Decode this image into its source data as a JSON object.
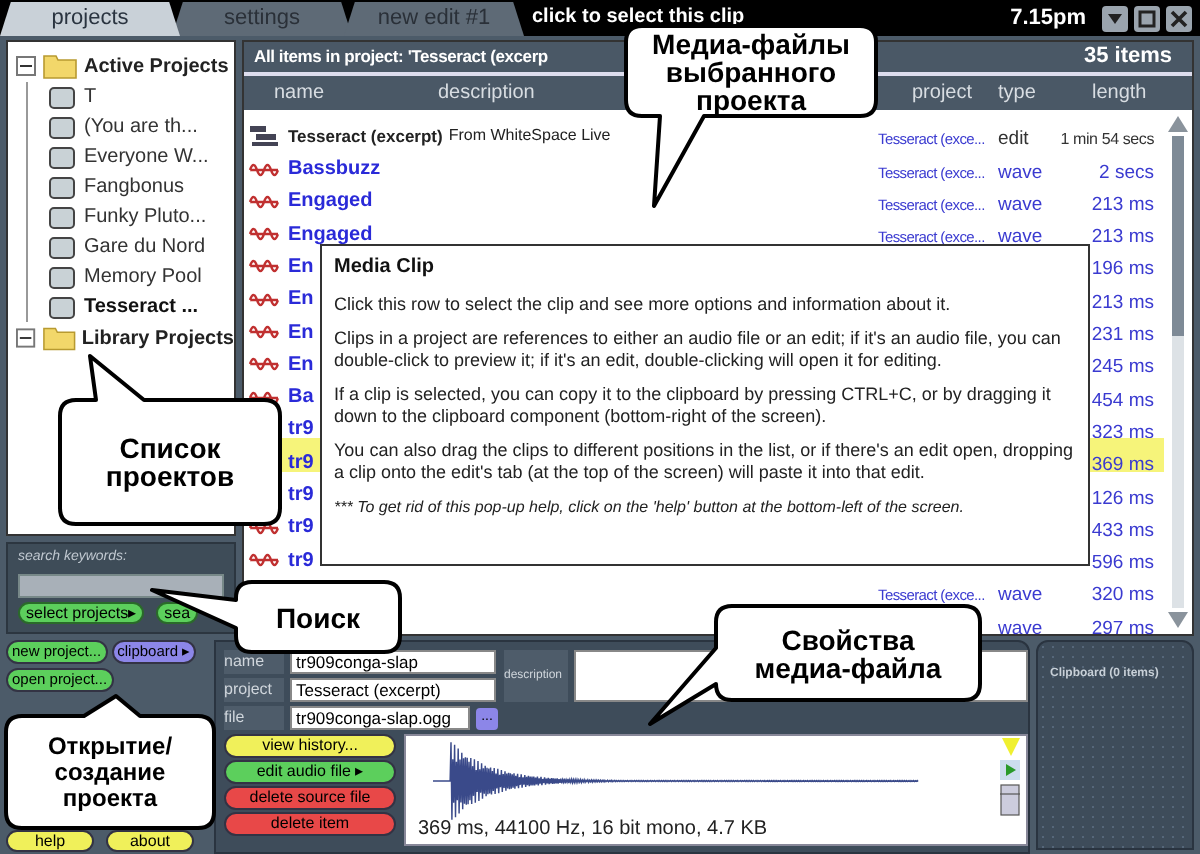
{
  "tabs": [
    {
      "label": "projects",
      "selected": true
    },
    {
      "label": "settings",
      "selected": false
    },
    {
      "label": "new edit #1",
      "selected": false
    }
  ],
  "hint": "click to select this clip",
  "clock": "7.15pm",
  "project_tree": [
    {
      "label": "Active Projects",
      "expanded": true,
      "children": [
        {
          "label": "T",
          "selected": false
        },
        {
          "label": "(You are th...",
          "selected": false
        },
        {
          "label": "Everyone W...",
          "selected": false
        },
        {
          "label": "Fangbonus",
          "selected": false
        },
        {
          "label": "Funky Pluto...",
          "selected": false
        },
        {
          "label": "Gare du Nord",
          "selected": false
        },
        {
          "label": "Memory Pool",
          "selected": false
        },
        {
          "label": "Tesseract ...",
          "selected": true
        }
      ]
    },
    {
      "label": "Library Projects",
      "expanded": true
    }
  ],
  "search": {
    "label": "search keywords:",
    "buttons": [
      {
        "label": "select projects▸"
      },
      {
        "label": "sea"
      }
    ]
  },
  "project_buttons": [
    {
      "label": "new project...",
      "color": "#5ccf5c"
    },
    {
      "label": "clipboard ▸",
      "color": "#8c86e8"
    },
    {
      "label": "open project...",
      "color": "#5ccf5c"
    }
  ],
  "bottom_buttons": [
    {
      "label": "help"
    },
    {
      "label": "about"
    }
  ],
  "list": {
    "title": "All items in project: 'Tesseract (excerp",
    "count": "35 items",
    "columns": [
      "name",
      "description",
      "project",
      "type",
      "length"
    ],
    "rows": [
      {
        "kind": "edit",
        "name": "Tesseract (excerpt)",
        "description": "From WhiteSpace Live",
        "project": "Tesseract (exce...",
        "type": "edit",
        "length": "1 min 54 secs",
        "selected": false
      },
      {
        "kind": "wave",
        "name": "Bassbuzz",
        "project": "Tesseract (exce...",
        "type": "wave",
        "length": "2 secs",
        "selected": false
      },
      {
        "kind": "wave",
        "name": "Engaged",
        "project": "Tesseract (exce...",
        "type": "wave",
        "length": "213 ms",
        "selected": false
      },
      {
        "kind": "wave",
        "name": "Engaged",
        "project": "Tesseract (exce...",
        "type": "wave",
        "length": "213 ms",
        "selected": false
      },
      {
        "kind": "wave",
        "name": "En",
        "length": "196 ms",
        "selected": false
      },
      {
        "kind": "wave",
        "name": "En",
        "length": "213 ms",
        "selected": false
      },
      {
        "kind": "wave",
        "name": "En",
        "length": "231 ms",
        "selected": false
      },
      {
        "kind": "wave",
        "name": "En",
        "length": "245 ms",
        "selected": false
      },
      {
        "kind": "wave",
        "name": "Ba",
        "length": "454 ms",
        "selected": false
      },
      {
        "name": "tr9",
        "length": "323 ms",
        "selected": false
      },
      {
        "name": "tr9",
        "length": "369 ms",
        "selected": true
      },
      {
        "name": "tr9",
        "length": "126 ms",
        "selected": false
      },
      {
        "kind": "wave",
        "name": "tr9",
        "length": "433 ms",
        "selected": false
      },
      {
        "kind": "wave",
        "name": "tr9",
        "length": "596 ms",
        "selected": false
      },
      {
        "project": "Tesseract (exce...",
        "type": "wave",
        "length": "320 ms",
        "selected": false
      },
      {
        "type": "wave",
        "length": "297 ms",
        "selected": false
      }
    ]
  },
  "popup": {
    "title": "Media Clip",
    "paragraphs": [
      "Click this row to select the clip and see more options and information about it.",
      "Clips in a project are references to either an audio file or an edit; if it's an audio file, you can double-click to preview it; if it's an edit, double-clicking will open it for editing.",
      "If a clip is selected, you can copy it to the clipboard by pressing CTRL+C, or by dragging it down to the clipboard component (bottom-right of the screen).",
      "You can also drag the clips to different positions in the list, or if there's an edit open, dropping a clip onto the edit's tab (at the top of the screen) will paste it into that edit."
    ],
    "note": "*** To get rid of this pop-up help, click on the 'help' button at the bottom-left of the screen."
  },
  "properties": {
    "fields": [
      {
        "label": "name",
        "value": "tr909conga-slap"
      },
      {
        "label": "project",
        "value": "Tesseract (excerpt)"
      },
      {
        "label": "file",
        "value": "tr909conga-slap.ogg"
      }
    ],
    "description_label": "description",
    "browse": "...",
    "actions": [
      {
        "label": "view history...",
        "color": "#f0f05a"
      },
      {
        "label": "edit audio file ▸",
        "color": "#5ccf5c"
      },
      {
        "label": "delete source file",
        "color": "#e84848"
      },
      {
        "label": "delete item",
        "color": "#e84848"
      }
    ],
    "waveform_info": "369 ms, 44100 Hz, 16 bit mono, 4.7 KB"
  },
  "clipboard": {
    "title": "Clipboard (0 items)"
  },
  "callouts": [
    {
      "text": "Медиа-файлы выбранного проекта"
    },
    {
      "text": "Список проектов"
    },
    {
      "text": "Поиск"
    },
    {
      "text": "Свойства медиа-файла"
    },
    {
      "text": "Открытие/ создание проекта"
    }
  ]
}
